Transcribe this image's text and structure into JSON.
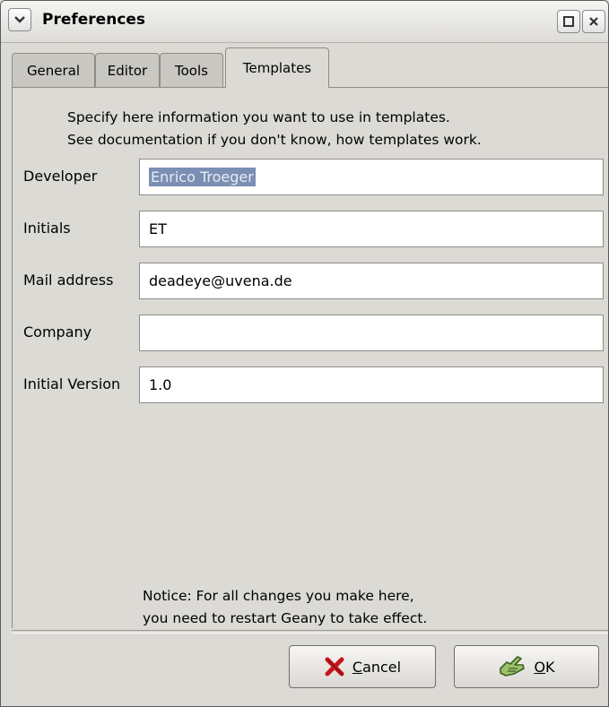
{
  "window": {
    "title": "Preferences"
  },
  "tabs": [
    {
      "label": "General",
      "active": false
    },
    {
      "label": "Editor",
      "active": false
    },
    {
      "label": "Tools",
      "active": false
    },
    {
      "label": "Templates",
      "active": true
    }
  ],
  "templates": {
    "intro_line1": "Specify here information you want to use in templates.",
    "intro_line2": "See documentation if you don't know, how templates work.",
    "fields": [
      {
        "label": "Developer",
        "value": "Enrico Troeger",
        "selected": true
      },
      {
        "label": "Initials",
        "value": "ET"
      },
      {
        "label": "Mail address",
        "value": "deadeye@uvena.de"
      },
      {
        "label": "Company",
        "value": ""
      },
      {
        "label": "Initial Version",
        "value": "1.0"
      }
    ],
    "notice_line1": "Notice: For all changes you make here,",
    "notice_line2": "you need to restart Geany to take effect."
  },
  "buttons": {
    "cancel_mnemonic": "C",
    "cancel_rest": "ancel",
    "ok_mnemonic": "O",
    "ok_rest": "K"
  },
  "icons": {
    "menu": "chevron-down-icon",
    "maximize": "maximize-icon",
    "close": "close-icon",
    "cancel": "cancel-x-icon",
    "ok": "ok-hand-icon"
  },
  "colors": {
    "selection_bg": "#7b8fb3",
    "dialog_bg": "#dcdad5"
  }
}
